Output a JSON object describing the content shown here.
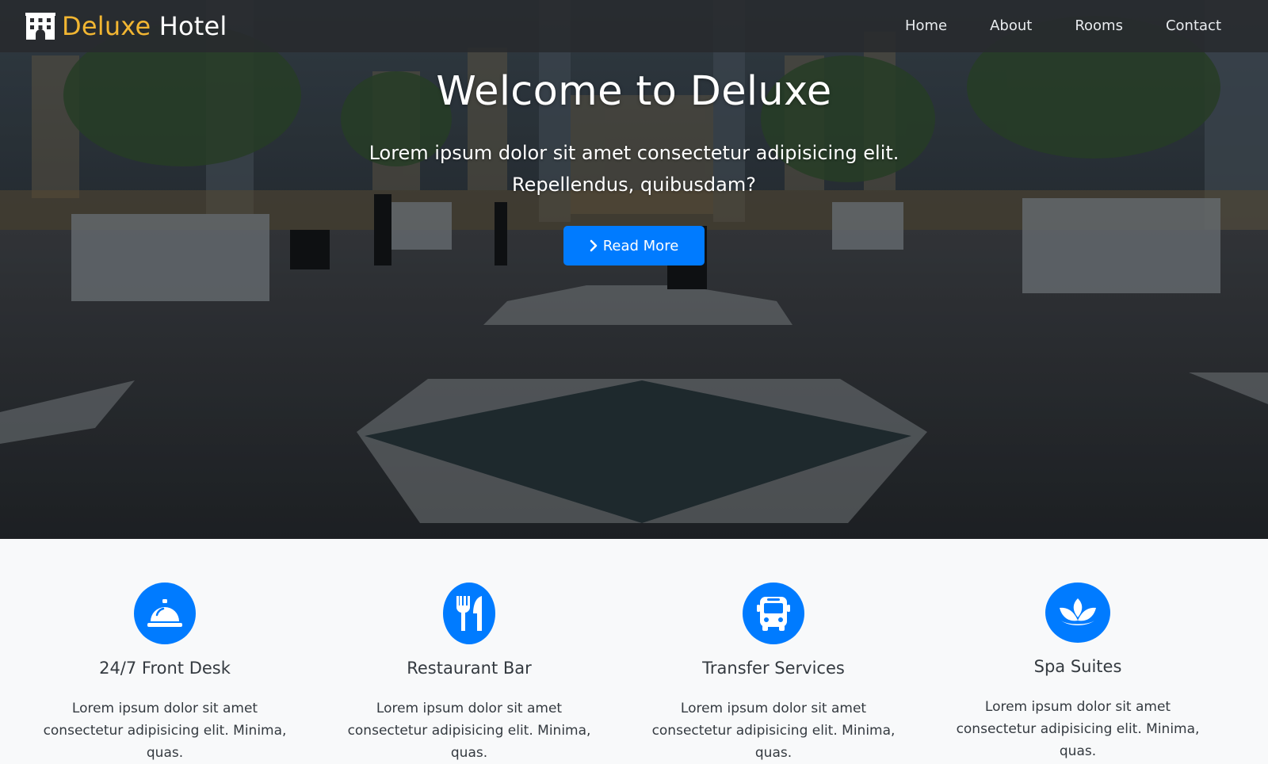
{
  "navbar": {
    "brand_accent": "Deluxe",
    "brand_rest": "Hotel",
    "brand_icon": "hotel-building-icon",
    "links": [
      "Home",
      "About",
      "Rooms",
      "Contact"
    ]
  },
  "hero": {
    "title": "Welcome to Deluxe",
    "subtitle": "Lorem ipsum dolor sit amet consectetur adipisicing elit. Repellendus, quibusdam?",
    "button_label": "Read More",
    "button_icon": "chevron-right-icon"
  },
  "services": [
    {
      "icon": "bell-icon",
      "title": "24/7 Front Desk",
      "text": "Lorem ipsum dolor sit amet consectetur adipisicing elit. Minima, quas."
    },
    {
      "icon": "utensils-icon",
      "title": "Restaurant Bar",
      "text": "Lorem ipsum dolor sit amet consectetur adipisicing elit. Minima, quas."
    },
    {
      "icon": "bus-icon",
      "title": "Transfer Services",
      "text": "Lorem ipsum dolor sit amet consectetur adipisicing elit. Minima, quas."
    },
    {
      "icon": "spa-icon",
      "title": "Spa Suites",
      "text": "Lorem ipsum dolor sit amet consectetur adipisicing elit. Minima, quas."
    }
  ],
  "colors": {
    "accent": "#007bff",
    "brand_gold": "#f2b632",
    "navbar_bg": "#2a2c30",
    "section_bg": "#f8f9fa"
  }
}
